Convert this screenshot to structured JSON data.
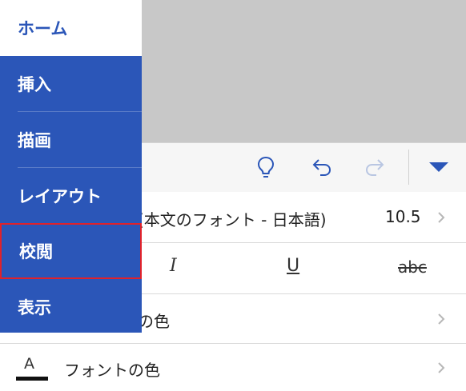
{
  "menu": {
    "items": [
      {
        "label": "ホーム"
      },
      {
        "label": "挿入"
      },
      {
        "label": "描画"
      },
      {
        "label": "レイアウト"
      },
      {
        "label": "校閲"
      },
      {
        "label": "表示"
      }
    ]
  },
  "toolbar": {
    "icons": [
      "lightbulb-icon",
      "undo-icon",
      "redo-icon",
      "dropdown-triangle-icon"
    ]
  },
  "format": {
    "font_name": "(本文のフォント - 日本語)",
    "font_size": "10.5",
    "italic": "I",
    "underline": "U",
    "strikethrough": "abc",
    "highlight_label": "の色",
    "font_color_glyph": "A",
    "font_color_label": "フォントの色"
  },
  "colors": {
    "menu_bg": "#2b56b8",
    "accent": "#2b56b8",
    "selection_border": "#e0222b"
  }
}
